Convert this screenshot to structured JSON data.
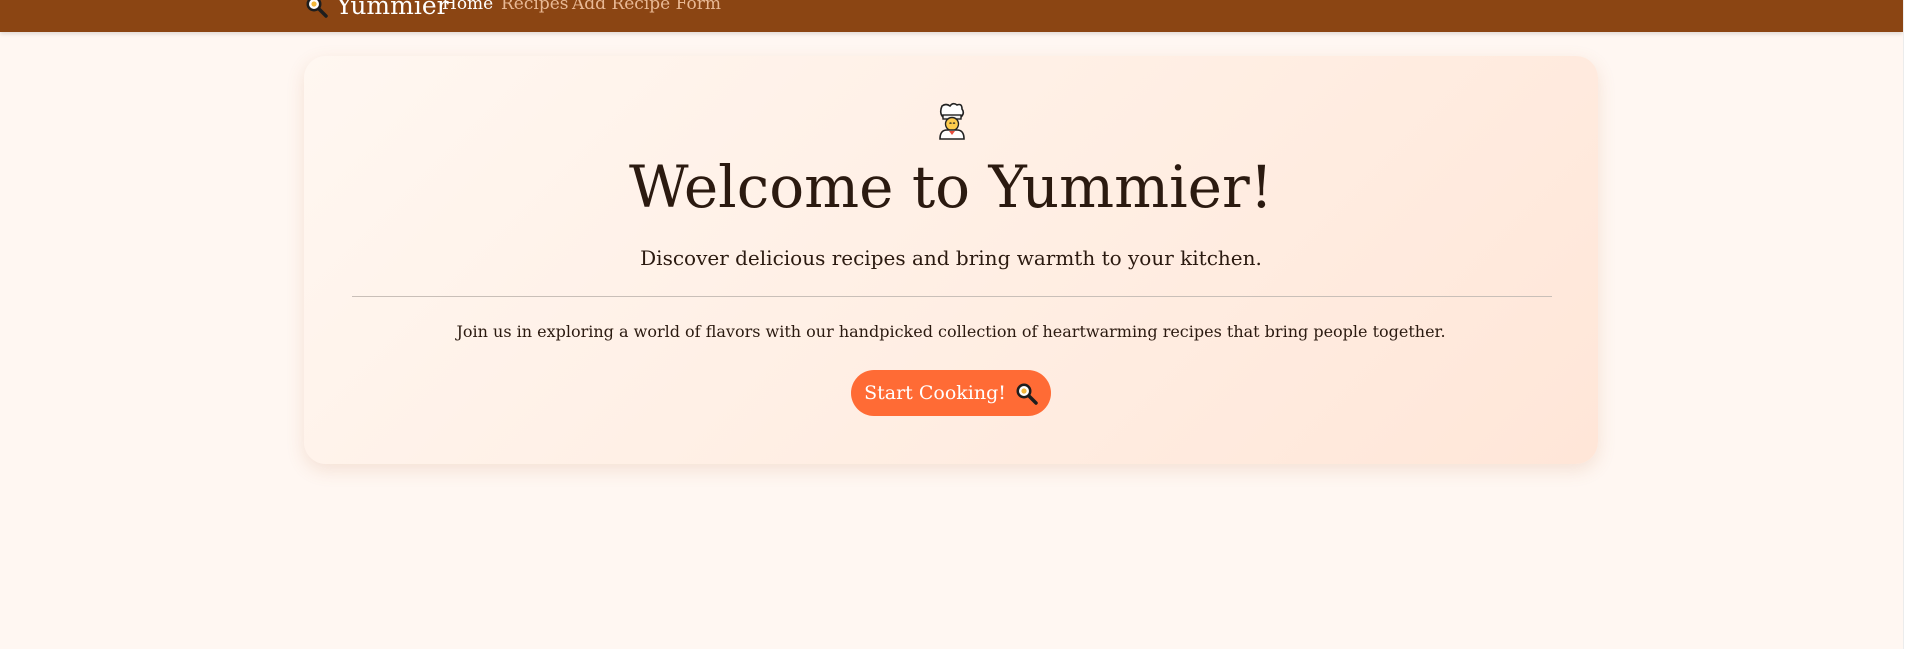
{
  "navbar": {
    "brand": "Yummier",
    "brand_icon": "frying-pan-icon",
    "links": [
      {
        "label": "Home",
        "active": true
      },
      {
        "label": "Recipes",
        "active": false
      },
      {
        "label": "Add Recipe Form",
        "active": false
      }
    ]
  },
  "hero": {
    "icon": "chef-icon",
    "title": "Welcome to Yummier!",
    "subtitle": "Discover delicious recipes and bring warmth to your kitchen.",
    "body": "Join us in exploring a world of flavors with our handpicked collection of heartwarming recipes that bring people together.",
    "cta_label": "Start Cooking!",
    "cta_icon": "frying-pan-icon"
  },
  "colors": {
    "navbar": "#8b4513",
    "accent": "#ff6b35",
    "background": "#fff7f2",
    "text": "#2b1a10"
  }
}
